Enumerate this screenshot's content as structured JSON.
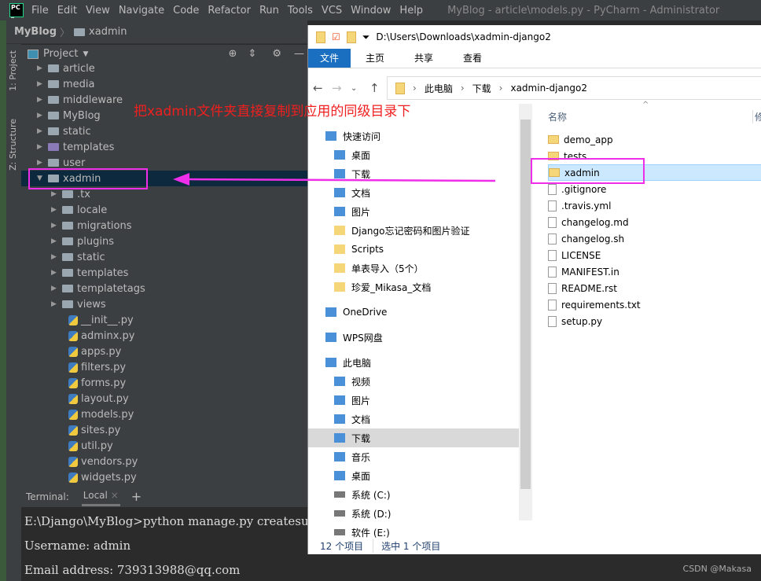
{
  "ide": {
    "menu": [
      "File",
      "Edit",
      "View",
      "Navigate",
      "Code",
      "Refactor",
      "Run",
      "Tools",
      "VCS",
      "Window",
      "Help"
    ],
    "title": "MyBlog - article\\models.py - PyCharm - Administrator",
    "breadcrumb": [
      "MyBlog",
      "xadmin"
    ],
    "side_tabs": [
      "1: Project",
      "Z: Structure"
    ],
    "panel_title": "Project",
    "top_folders": [
      "article",
      "media",
      "middleware",
      "MyBlog",
      "static",
      "templates",
      "user",
      "xadmin"
    ],
    "xadmin_children": [
      ".tx",
      "locale",
      "migrations",
      "plugins",
      "static",
      "templates",
      "templatetags",
      "views"
    ],
    "xadmin_files": [
      "__init__.py",
      "adminx.py",
      "apps.py",
      "filters.py",
      "forms.py",
      "layout.py",
      "models.py",
      "sites.py",
      "util.py",
      "vendors.py",
      "widgets.py"
    ],
    "terminal": {
      "label": "Terminal:",
      "tab": "Local",
      "lines": [
        "E:\\Django\\MyBlog>python manage.py createsuperuser",
        "Username: admin",
        "Email address: 739313988@qq.com"
      ]
    }
  },
  "explorer": {
    "path": "D:\\Users\\Downloads\\xadmin-django2",
    "ribbon": [
      "文件",
      "主页",
      "共享",
      "查看"
    ],
    "address": [
      "此电脑",
      "下载",
      "xadmin-django2"
    ],
    "sidebar": [
      "快速访问",
      "桌面",
      "下载",
      "文档",
      "图片",
      "Django忘记密码和图片验证",
      "Scripts",
      "单表导入（5个）",
      "珍爱_Mikasa_文档",
      "OneDrive",
      "WPS网盘",
      "此电脑",
      "视频",
      "图片",
      "文档",
      "下载",
      "音乐",
      "桌面",
      "系统 (C:)",
      "系统 (D:)",
      "软件 (E:)"
    ],
    "column": "名称",
    "column2": "修",
    "files": [
      "demo_app",
      "tests",
      "xadmin",
      ".gitignore",
      ".travis.yml",
      "changelog.md",
      "changelog.sh",
      "LICENSE",
      "MANIFEST.in",
      "README.rst",
      "requirements.txt",
      "setup.py"
    ],
    "status": [
      "12 个项目",
      "选中 1 个项目"
    ]
  },
  "annotation": "把xadmin文件夹直接复制到应用的同级目录下",
  "watermark": "CSDN @Makasa",
  "colors": {
    "highlight": "#ee2ee8",
    "note": "#f01f1f"
  }
}
